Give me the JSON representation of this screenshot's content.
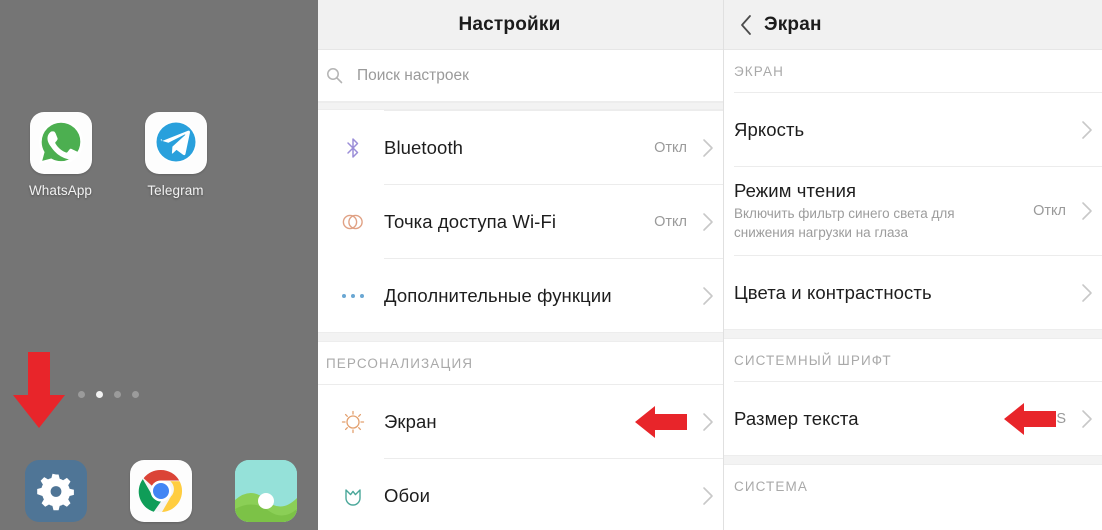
{
  "home": {
    "wallpaper_color": "#757575",
    "apps": [
      {
        "label": "WhatsApp",
        "icon": "whatsapp-icon"
      },
      {
        "label": "Telegram",
        "icon": "telegram-icon"
      }
    ],
    "page_dots": {
      "count": 4,
      "active_index": 1
    },
    "dock": [
      {
        "label": "",
        "icon": "settings-gear-icon"
      },
      {
        "label": "",
        "icon": "chrome-icon"
      },
      {
        "label": "",
        "icon": "gallery-icon"
      }
    ],
    "pointer_arrow": {
      "direction": "down",
      "color": "#e8252a",
      "target": "settings-gear-icon"
    }
  },
  "settings": {
    "title": "Настройки",
    "search": {
      "placeholder": "Поиск настроек",
      "icon": "search-icon"
    },
    "rows": [
      {
        "icon": "bluetooth-icon",
        "icon_color": "#8d7fd0",
        "title": "Bluetooth",
        "value": "Откл",
        "chevron": true
      },
      {
        "icon": "hotspot-icon",
        "icon_color": "#e08a6a",
        "title": "Точка доступа Wi-Fi",
        "value": "Откл",
        "chevron": true
      },
      {
        "icon": "more-dots-icon",
        "icon_color": "#5b9ec9",
        "title": "Дополнительные функции",
        "value": "",
        "chevron": true
      }
    ],
    "section_label": "ПЕРСОНАЛИЗАЦИЯ",
    "section_rows": [
      {
        "icon": "brightness-sun-icon",
        "icon_color": "#e0935e",
        "title": "Экран",
        "value": "",
        "chevron": true,
        "arrow": true
      },
      {
        "icon": "wallpaper-tulip-icon",
        "icon_color": "#4aa79a",
        "title": "Обои",
        "value": "",
        "chevron": true,
        "arrow": false
      }
    ]
  },
  "display": {
    "title": "Экран",
    "back_icon": "chevron-left-icon",
    "sections": [
      {
        "label": "ЭКРАН",
        "rows": [
          {
            "title": "Яркость",
            "subtitle": "",
            "value": "",
            "chevron": true,
            "arrow": false
          },
          {
            "title": "Режим чтения",
            "subtitle": "Включить фильтр синего света для снижения нагрузки на глаза",
            "value": "Откл",
            "chevron": true,
            "arrow": false
          },
          {
            "title": "Цвета и контрастность",
            "subtitle": "",
            "value": "",
            "chevron": true,
            "arrow": false
          }
        ]
      },
      {
        "label": "СИСТЕМНЫЙ ШРИФТ",
        "rows": [
          {
            "title": "Размер текста",
            "subtitle": "",
            "value": "S",
            "chevron": true,
            "arrow": true
          }
        ]
      },
      {
        "label": "СИСТЕМА",
        "rows": []
      }
    ]
  },
  "colors": {
    "accent_red": "#e8252a",
    "appbar_bg": "#f1f1f1",
    "divider": "#ececec",
    "muted_text": "#9a9a9a"
  }
}
